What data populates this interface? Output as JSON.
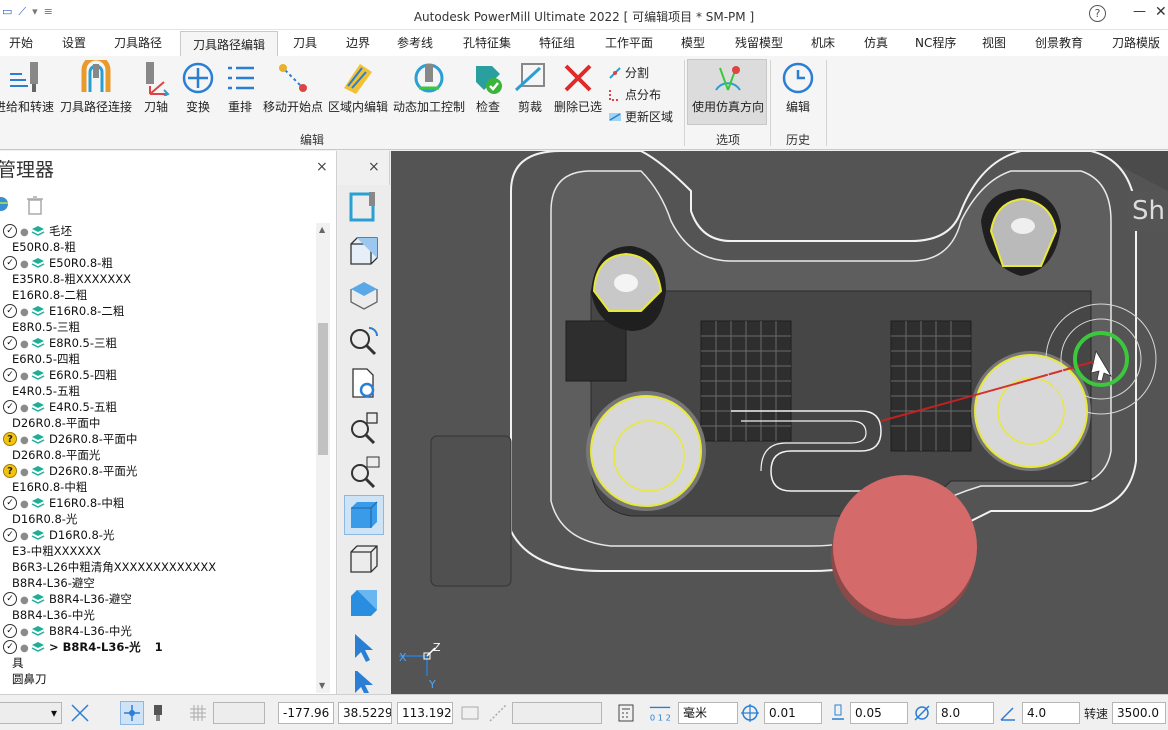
{
  "window": {
    "title": "Autodesk PowerMill Ultimate 2022   [ 可编辑项目 * SM-PM ]",
    "help": "?",
    "minimize": "—",
    "close": "✕"
  },
  "menu_tabs": [
    "开始",
    "设置",
    "刀具路径",
    "刀具路径编辑",
    "刀具",
    "边界",
    "参考线",
    "孔特征集",
    "特征组",
    "工作平面",
    "模型",
    "残留模型",
    "机床",
    "仿真",
    "NC程序",
    "视图",
    "创景教育",
    "刀路模版"
  ],
  "active_tab": "刀具路径编辑",
  "ribbon": {
    "buttons": [
      {
        "label": "进给和转速",
        "icon": "feed-speed-icon"
      },
      {
        "label": "刀具路径连接",
        "icon": "toolpath-link-icon"
      },
      {
        "label": "刀轴",
        "icon": "tool-axis-icon"
      },
      {
        "label": "变换",
        "icon": "transform-icon"
      },
      {
        "label": "重排",
        "icon": "reorder-icon"
      },
      {
        "label": "移动开始点",
        "icon": "move-start-icon"
      },
      {
        "label": "区域内编辑",
        "icon": "region-edit-icon"
      },
      {
        "label": "动态加工控制",
        "icon": "dynamic-control-icon"
      },
      {
        "label": "检查",
        "icon": "check-icon"
      },
      {
        "label": "剪裁",
        "icon": "clip-icon"
      },
      {
        "label": "删除已选",
        "icon": "delete-selected-icon"
      }
    ],
    "small_buttons": [
      {
        "label": "分割",
        "icon": "split-icon"
      },
      {
        "label": "点分布",
        "icon": "point-dist-icon"
      },
      {
        "label": "更新区域",
        "icon": "update-region-icon"
      }
    ],
    "option_button": {
      "label": "使用仿真方向",
      "icon": "sim-direction-icon"
    },
    "history_button": {
      "label": "编辑",
      "icon": "history-edit-icon"
    },
    "groups": {
      "edit": "编辑",
      "options": "选项",
      "history": "历史"
    }
  },
  "explorer": {
    "title": "管理器",
    "close": "×",
    "items": [
      {
        "type": "toolpath",
        "status": "ok",
        "name": "毛坯"
      },
      {
        "type": "label",
        "name": "E50R0.8-粗"
      },
      {
        "type": "toolpath",
        "status": "ok",
        "name": "E50R0.8-粗"
      },
      {
        "type": "label",
        "name": "E35R0.8-粗XXXXXXX"
      },
      {
        "type": "label",
        "name": "E16R0.8-二粗"
      },
      {
        "type": "toolpath",
        "status": "ok",
        "name": "E16R0.8-二粗"
      },
      {
        "type": "label",
        "name": "E8R0.5-三粗"
      },
      {
        "type": "toolpath",
        "status": "ok",
        "name": "E8R0.5-三粗"
      },
      {
        "type": "label",
        "name": "E6R0.5-四粗"
      },
      {
        "type": "toolpath",
        "status": "ok",
        "name": "E6R0.5-四粗"
      },
      {
        "type": "label",
        "name": "E4R0.5-五粗"
      },
      {
        "type": "toolpath",
        "status": "ok",
        "name": "E4R0.5-五粗"
      },
      {
        "type": "label",
        "name": "D26R0.8-平面中"
      },
      {
        "type": "toolpath",
        "status": "warn",
        "name": "D26R0.8-平面中"
      },
      {
        "type": "label",
        "name": "D26R0.8-平面光"
      },
      {
        "type": "toolpath",
        "status": "warn",
        "name": "D26R0.8-平面光"
      },
      {
        "type": "label",
        "name": "E16R0.8-中粗"
      },
      {
        "type": "toolpath",
        "status": "ok",
        "name": "E16R0.8-中粗"
      },
      {
        "type": "label",
        "name": "D16R0.8-光"
      },
      {
        "type": "toolpath",
        "status": "ok",
        "name": "D16R0.8-光"
      },
      {
        "type": "label",
        "name": "E3-中粗XXXXXX"
      },
      {
        "type": "label",
        "name": "B6R3-L26中粗清角XXXXXXXXXXXXX"
      },
      {
        "type": "label",
        "name": "B8R4-L36-避空"
      },
      {
        "type": "toolpath",
        "status": "ok",
        "name": "B8R4-L36-避空"
      },
      {
        "type": "label",
        "name": "B8R4-L36-中光"
      },
      {
        "type": "toolpath",
        "status": "ok",
        "name": "B8R4-L36-中光"
      },
      {
        "type": "toolpath",
        "status": "active",
        "name": "> B8R4-L36-光",
        "count": "1"
      },
      {
        "type": "label",
        "name": "具"
      },
      {
        "type": "label",
        "name": "圆鼻刀"
      }
    ]
  },
  "vtools": {
    "close": "×",
    "buttons": [
      "toolpath-view-icon",
      "iso-view-icon",
      "top-view-icon",
      "zoom-refresh-icon",
      "page-refresh-icon",
      "zoom-fit-icon",
      "zoom-box-icon",
      "shaded-icon",
      "wireframe-icon",
      "stock-view-icon",
      "select-icon",
      "rotate-icon"
    ]
  },
  "viewport": {
    "overlay_text": "Sh",
    "axis_labels": {
      "x": "X",
      "y": "Y",
      "z": "Z"
    },
    "colors": {
      "background": "#4a4a4a",
      "boundary": "#ffffff",
      "highlight": "#e8e83a",
      "tool": "#d46868",
      "cursor_ring": "#3cc83c",
      "trace": "#d02020"
    }
  },
  "statusbar": {
    "x": "-177.96",
    "y": "38.5229",
    "z": "113.192",
    "units": "毫米",
    "tolerance": "0.01",
    "thickness": "0.05",
    "diameter": "8.0",
    "angle": "4.0",
    "spindle_label": "转速",
    "spindle": "3500.0"
  }
}
